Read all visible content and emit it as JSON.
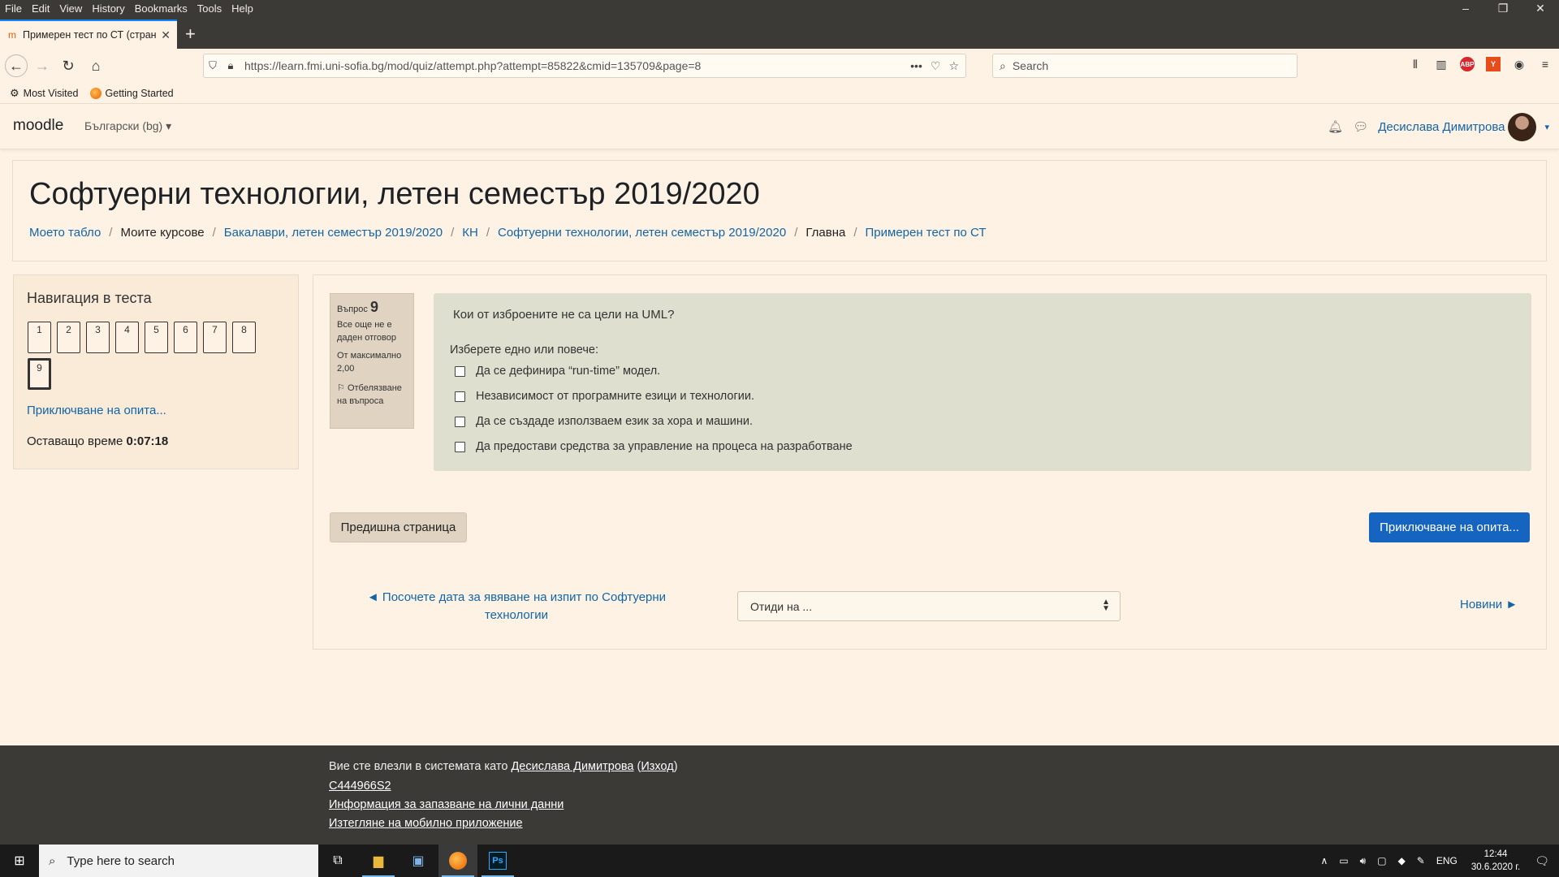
{
  "menubar": [
    "File",
    "Edit",
    "View",
    "History",
    "Bookmarks",
    "Tools",
    "Help"
  ],
  "window_controls": [
    "–",
    "❐",
    "✕"
  ],
  "tab": {
    "title": "Примерен тест по СТ (страница",
    "close": "✕"
  },
  "new_tab": "+",
  "url": "https://learn.fmi.uni-sofia.bg/mod/quiz/attempt.php?attempt=85822&cmid=135709&page=8",
  "url_actions": [
    "•••",
    "♡",
    "☆"
  ],
  "search_placeholder": "Search",
  "bookmarks": [
    "Most Visited",
    "Getting Started"
  ],
  "header": {
    "brand": "moodle",
    "language": "Български (bg) ▾",
    "user": "Десислава Димитрова",
    "caret": "▾"
  },
  "course_title": "Софтуерни технологии, летен семестър 2019/2020",
  "breadcrumb": [
    {
      "label": "Моето табло",
      "link": true
    },
    {
      "label": "Моите курсове",
      "link": false
    },
    {
      "label": "Бакалаври, летен семестър 2019/2020",
      "link": true
    },
    {
      "label": "КН",
      "link": true
    },
    {
      "label": "Софтуерни технологии, летен семестър 2019/2020",
      "link": true
    },
    {
      "label": "Главна",
      "link": false
    },
    {
      "label": "Примерен тест по СТ",
      "link": true
    }
  ],
  "quiz_nav": {
    "title": "Навигация в теста",
    "questions": [
      "1",
      "2",
      "3",
      "4",
      "5",
      "6",
      "7",
      "8",
      "9"
    ],
    "current": "9",
    "finish_link": "Приключване на опита...",
    "time_label": "Оставащо време",
    "time_value": "0:07:18"
  },
  "question": {
    "label": "Въпрос",
    "number": "9",
    "status": "Все още не е даден отговор",
    "marks": "От максимално 2,00",
    "flag": "Отбелязване на въпроса",
    "text": "Кои от изброените не са цели на UML?",
    "prompt": "Изберете едно или повече:",
    "options": [
      "Да се дефинира “run-time” модел.",
      "Независимост от програмните езици и технологии.",
      "Да се създаде използваем език за хора и машини.",
      "Да предостави средства за управление на процеса на разработване"
    ]
  },
  "buttons": {
    "previous_page": "Предишна страница",
    "finish_attempt": "Приключване на опита..."
  },
  "activity_nav": {
    "previous": "◄ Посочете дата за явяване на изпит по Софтуерни технологии",
    "jump": "Отиди на ...",
    "next": "Новини ►"
  },
  "footer": {
    "logged_in_prefix": "Вие сте влезли в системата като ",
    "user": "Десислава Димитрова",
    "logout": "Изход",
    "code": "C444966S2",
    "privacy": "Информация за запазване на лични данни",
    "mobile": "Изтегляне на мобилно приложение"
  },
  "taskbar": {
    "search_placeholder": "Type here to search",
    "language": "ENG",
    "time": "12:44",
    "date": "30.6.2020 г.",
    "ps_label": "Ps"
  },
  "colors": {
    "accent": "#1565c0",
    "link": "#1265a8",
    "page_bg": "#fdf2e3",
    "chrome": "#3b3a36"
  }
}
